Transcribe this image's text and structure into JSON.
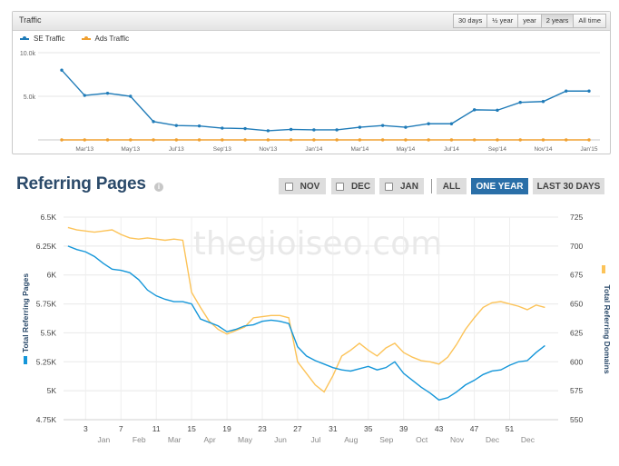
{
  "traffic": {
    "title": "Traffic",
    "range_buttons": [
      {
        "label": "30 days",
        "active": false
      },
      {
        "label": "½ year",
        "active": false
      },
      {
        "label": "year",
        "active": false
      },
      {
        "label": "2 years",
        "active": true
      },
      {
        "label": "All time",
        "active": false
      }
    ],
    "legend": [
      {
        "label": "SE Traffic",
        "color": "#1f7bb8"
      },
      {
        "label": "Ads Traffic",
        "color": "#f0a030"
      }
    ]
  },
  "referring": {
    "title": "Referring Pages",
    "info_icon": "info-icon",
    "filters": [
      {
        "label": "NOV",
        "checkbox": true,
        "active": false
      },
      {
        "label": "DEC",
        "checkbox": true,
        "active": false
      },
      {
        "label": "JAN",
        "checkbox": true,
        "active": false
      },
      {
        "label": "ALL",
        "checkbox": false,
        "active": false
      },
      {
        "label": "ONE YEAR",
        "checkbox": false,
        "active": true
      },
      {
        "label": "LAST 30 DAYS",
        "checkbox": false,
        "active": false
      }
    ],
    "watermark": "thegioiseo.com"
  },
  "chart_data": [
    {
      "type": "line",
      "x": [
        "Feb'13",
        "Mar'13",
        "Apr'13",
        "May'13",
        "Jun'13",
        "Jul'13",
        "Aug'13",
        "Sep'13",
        "Oct'13",
        "Nov'13",
        "Dec'13",
        "Jan'14",
        "Feb'14",
        "Mar'14",
        "Apr'14",
        "May'14",
        "Jun'14",
        "Jul'14",
        "Aug'14",
        "Sep'14",
        "Oct'14",
        "Nov'14",
        "Dec'14",
        "Jan'15"
      ],
      "x_ticks": [
        "Mar'13",
        "May'13",
        "Jul'13",
        "Sep'13",
        "Nov'13",
        "Jan'14",
        "Mar'14",
        "May'14",
        "Jul'14",
        "Sep'14",
        "Nov'14",
        "Jan'15"
      ],
      "series": [
        {
          "name": "SE Traffic",
          "color": "#1f7bb8",
          "values": [
            8000,
            5100,
            5350,
            5000,
            2100,
            1650,
            1600,
            1350,
            1300,
            1050,
            1200,
            1150,
            1150,
            1450,
            1650,
            1450,
            1850,
            1850,
            3450,
            3400,
            4300,
            4400,
            5600,
            5600
          ]
        },
        {
          "name": "Ads Traffic",
          "color": "#f0a030",
          "values": [
            0,
            0,
            0,
            0,
            0,
            0,
            0,
            0,
            0,
            0,
            0,
            0,
            0,
            0,
            0,
            0,
            0,
            0,
            0,
            0,
            0,
            0,
            0,
            0
          ]
        }
      ],
      "y_ticks": [
        "5.0k",
        "10.0k"
      ],
      "ylim": [
        0,
        10000
      ],
      "grid": true
    },
    {
      "type": "line",
      "x_week_ticks": [
        "3",
        "7",
        "11",
        "15",
        "19",
        "23",
        "27",
        "31",
        "35",
        "39",
        "43",
        "47",
        "51"
      ],
      "x_month_ticks": [
        "Jan",
        "Feb",
        "Mar",
        "Apr",
        "May",
        "Jun",
        "Jul",
        "Aug",
        "Sep",
        "Oct",
        "Nov",
        "Dec",
        "Dec"
      ],
      "ylabel_left": "Total Referring Pages",
      "ylabel_right": "Total Referring Domains",
      "yticks_left": [
        "4.75K",
        "5K",
        "5.25K",
        "5.5K",
        "5.75K",
        "6K",
        "6.25K",
        "6.5K"
      ],
      "yticks_right": [
        "550",
        "575",
        "600",
        "625",
        "650",
        "675",
        "700",
        "725"
      ],
      "ylim_left": [
        4750,
        6500
      ],
      "ylim_right": [
        550,
        725
      ],
      "series": [
        {
          "name": "Total Referring Pages",
          "axis": "left",
          "color": "#1496d9",
          "x": [
            1,
            2,
            3,
            4,
            5,
            6,
            7,
            8,
            9,
            10,
            11,
            12,
            13,
            14,
            15,
            16,
            17,
            18,
            19,
            20,
            21,
            22,
            23,
            24,
            25,
            26,
            27,
            28,
            29,
            30,
            31,
            32,
            33,
            34,
            35,
            36,
            37,
            38,
            39,
            40,
            41,
            42,
            43,
            44,
            45,
            46,
            47,
            48,
            49,
            50,
            51,
            52,
            53,
            54,
            55
          ],
          "values": [
            6250,
            6220,
            6200,
            6160,
            6100,
            6050,
            6040,
            6020,
            5960,
            5870,
            5820,
            5790,
            5770,
            5770,
            5750,
            5620,
            5590,
            5560,
            5510,
            5530,
            5560,
            5570,
            5600,
            5610,
            5600,
            5580,
            5380,
            5300,
            5260,
            5230,
            5200,
            5180,
            5170,
            5190,
            5210,
            5180,
            5200,
            5250,
            5150,
            5090,
            5030,
            4980,
            4920,
            4940,
            4990,
            5050,
            5090,
            5140,
            5170,
            5180,
            5220,
            5250,
            5260,
            5330,
            5390
          ]
        },
        {
          "name": "Total Referring Domains",
          "axis": "right",
          "color": "#fcc358",
          "x": [
            1,
            2,
            3,
            4,
            5,
            6,
            7,
            8,
            9,
            10,
            11,
            12,
            13,
            14,
            15,
            16,
            17,
            18,
            19,
            20,
            21,
            22,
            23,
            24,
            25,
            26,
            27,
            28,
            29,
            30,
            31,
            32,
            33,
            34,
            35,
            36,
            37,
            38,
            39,
            40,
            41,
            42,
            43,
            44,
            45,
            46,
            47,
            48,
            49,
            50,
            51,
            52,
            53,
            54,
            55
          ],
          "values": [
            716,
            714,
            713,
            712,
            713,
            714,
            710,
            707,
            706,
            707,
            706,
            705,
            706,
            705,
            660,
            647,
            635,
            628,
            624,
            627,
            630,
            638,
            639,
            640,
            640,
            638,
            600,
            590,
            580,
            574,
            588,
            605,
            610,
            616,
            610,
            605,
            612,
            616,
            608,
            604,
            601,
            600,
            598,
            604,
            615,
            628,
            638,
            647,
            651,
            652,
            650,
            648,
            645,
            649,
            647
          ]
        }
      ],
      "grid": true
    }
  ]
}
